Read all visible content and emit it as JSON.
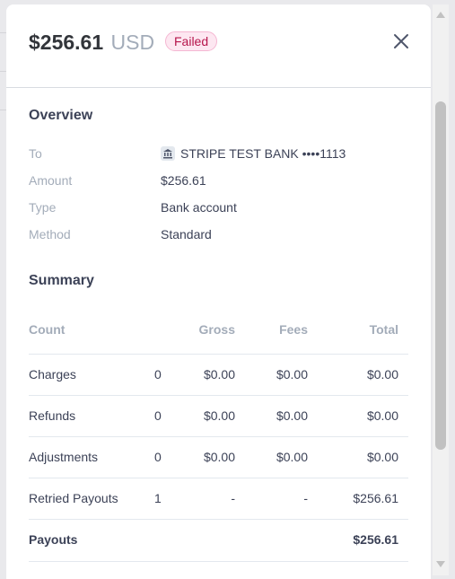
{
  "header": {
    "amount": "$256.61",
    "currency": "USD",
    "status": "Failed"
  },
  "overview": {
    "title": "Overview",
    "fields": [
      {
        "label": "To",
        "value": "STRIPE TEST BANK ••••1113",
        "icon": "bank-icon"
      },
      {
        "label": "Amount",
        "value": "$256.61"
      },
      {
        "label": "Type",
        "value": "Bank account"
      },
      {
        "label": "Method",
        "value": "Standard"
      }
    ]
  },
  "summary": {
    "title": "Summary",
    "columns": {
      "count": "Count",
      "gross": "Gross",
      "fees": "Fees",
      "total": "Total"
    },
    "rows": [
      {
        "name": "Charges",
        "count": "0",
        "gross": "$0.00",
        "fees": "$0.00",
        "total": "$0.00"
      },
      {
        "name": "Refunds",
        "count": "0",
        "gross": "$0.00",
        "fees": "$0.00",
        "total": "$0.00"
      },
      {
        "name": "Adjustments",
        "count": "0",
        "gross": "$0.00",
        "fees": "$0.00",
        "total": "$0.00"
      },
      {
        "name": "Retried Payouts",
        "count": "1",
        "gross": "-",
        "fees": "-",
        "total": "$256.61"
      },
      {
        "name": "Payouts",
        "count": "",
        "gross": "",
        "fees": "",
        "total": "$256.61"
      }
    ]
  },
  "colors": {
    "failed_badge_bg": "#fde7f1",
    "failed_badge_text": "#b6164c",
    "text_primary": "#3c4257",
    "text_muted": "#a3acb9"
  }
}
